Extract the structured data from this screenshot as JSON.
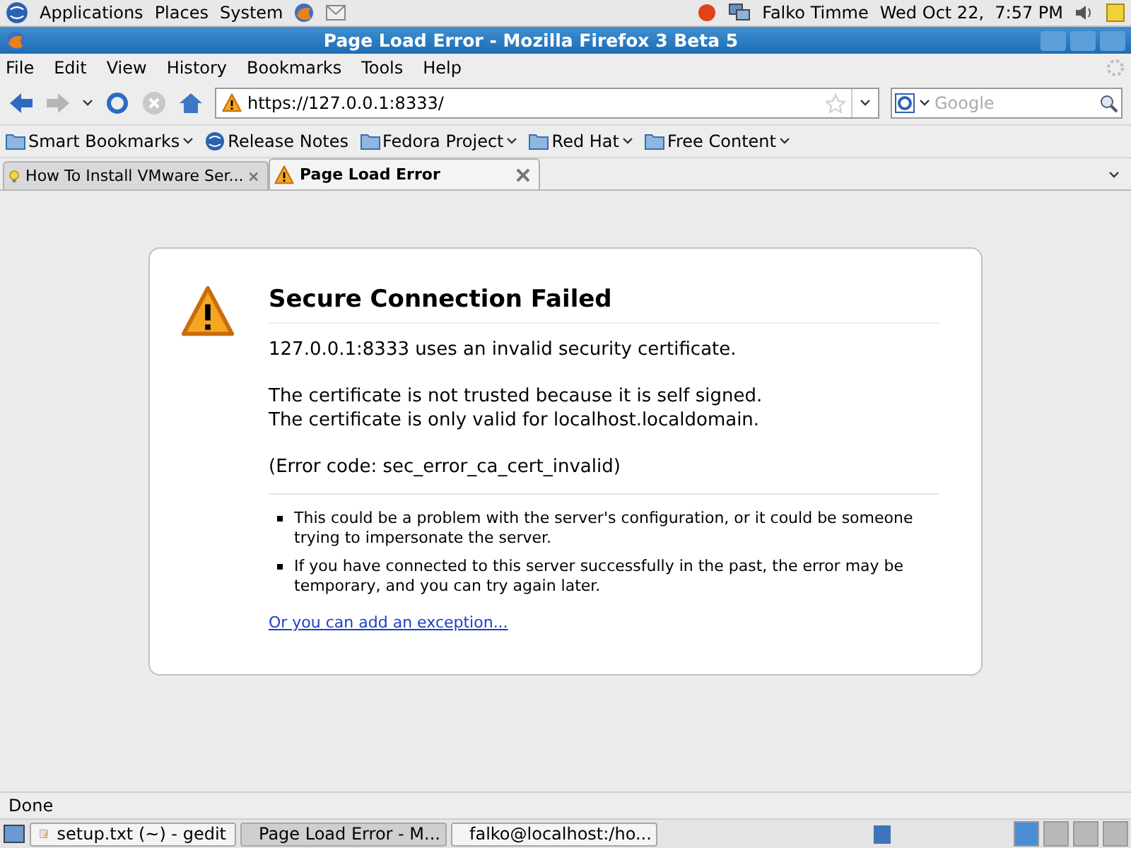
{
  "top_panel": {
    "menus": [
      "Applications",
      "Places",
      "System"
    ],
    "user": "Falko Timme",
    "clock": "Wed Oct 22,  7:57 PM"
  },
  "window": {
    "title": "Page Load Error - Mozilla Firefox 3 Beta 5"
  },
  "menubar": [
    "File",
    "Edit",
    "View",
    "History",
    "Bookmarks",
    "Tools",
    "Help"
  ],
  "navigation": {
    "url": "https://127.0.0.1:8333/",
    "search_placeholder": "Google"
  },
  "bookmarks": [
    {
      "label": "Smart Bookmarks",
      "kind": "folder-menu"
    },
    {
      "label": "Release Notes",
      "kind": "link"
    },
    {
      "label": "Fedora Project",
      "kind": "folder-menu"
    },
    {
      "label": "Red Hat",
      "kind": "folder-menu"
    },
    {
      "label": "Free Content",
      "kind": "folder-menu"
    }
  ],
  "tabs": [
    {
      "label": "How To Install VMware Ser...",
      "selected": false
    },
    {
      "label": "Page Load Error",
      "selected": true
    }
  ],
  "error": {
    "title": "Secure Connection Failed",
    "paragraphs": [
      [
        "127.0.0.1:8333 uses an invalid security certificate."
      ],
      [
        "The certificate is not trusted because it is self signed.",
        "The certificate is only valid for localhost.localdomain."
      ],
      [
        "(Error code: sec_error_ca_cert_invalid)"
      ]
    ],
    "bullets": [
      "This could be a problem with the server's configuration, or it could be someone trying to impersonate the server.",
      "If you have connected to this server successfully in the past, the error may be temporary, and you can try again later."
    ],
    "link": "Or you can add an exception..."
  },
  "status_bar": "Done",
  "taskbar": [
    {
      "label": "setup.txt (~) - gedit",
      "kind": "editor",
      "selected": false
    },
    {
      "label": "Page Load Error - M...",
      "kind": "browser",
      "selected": true
    },
    {
      "label": "falko@localhost:/ho...",
      "kind": "terminal",
      "selected": false
    }
  ]
}
